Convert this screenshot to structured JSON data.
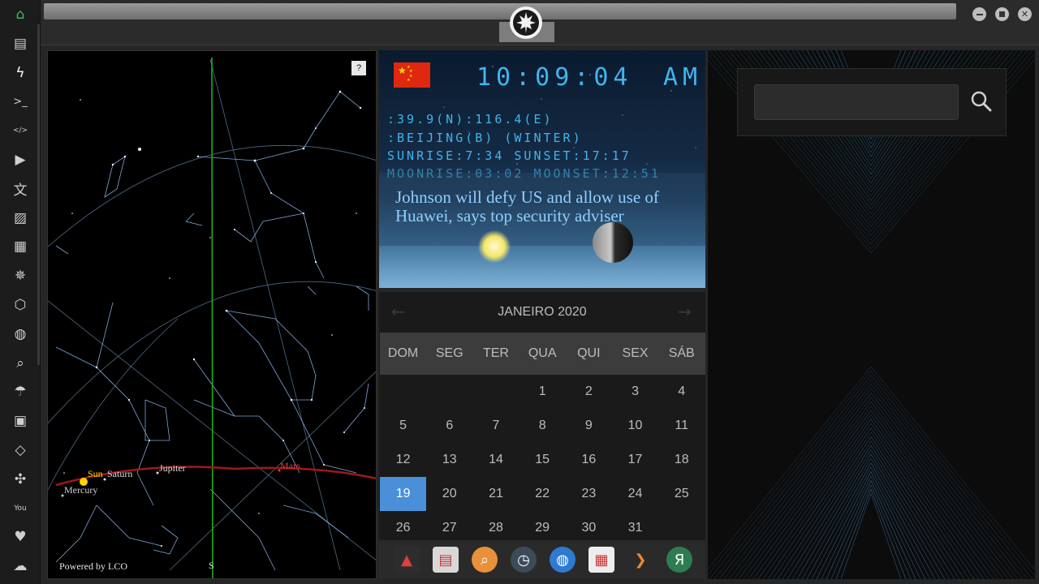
{
  "window": {
    "emblem": "rebel-alliance-icon"
  },
  "sidebar": {
    "items": [
      {
        "name": "home-icon",
        "glyph": "⌂"
      },
      {
        "name": "document-icon",
        "glyph": "▤"
      },
      {
        "name": "lightning-icon",
        "glyph": "ϟ"
      },
      {
        "name": "terminal-icon",
        "glyph": ">_"
      },
      {
        "name": "code-icon",
        "glyph": "</>"
      },
      {
        "name": "play-icon",
        "glyph": "▶"
      },
      {
        "name": "translate-icon",
        "glyph": "文"
      },
      {
        "name": "image-icon",
        "glyph": "▨"
      },
      {
        "name": "newspaper-icon",
        "glyph": "▦"
      },
      {
        "name": "galactic-empire-icon",
        "glyph": "✵"
      },
      {
        "name": "hexagon-icon",
        "glyph": "⬡"
      },
      {
        "name": "globe-icon",
        "glyph": "◍"
      },
      {
        "name": "search-icon",
        "glyph": "⌕"
      },
      {
        "name": "umbrella-icon",
        "glyph": "☂"
      },
      {
        "name": "contacts-icon",
        "glyph": "▣"
      },
      {
        "name": "dev-icon",
        "glyph": "◇"
      },
      {
        "name": "expand-icon",
        "glyph": "✣"
      },
      {
        "name": "youtube-icon",
        "glyph": "You"
      },
      {
        "name": "heart-icon",
        "glyph": "♥"
      },
      {
        "name": "cloud-icon",
        "glyph": "☁"
      }
    ]
  },
  "skymap": {
    "help_label": "?",
    "powered_by": "Powered by LCO",
    "south_label": "S",
    "planets": [
      {
        "label": "Sun",
        "color": "#ffd700"
      },
      {
        "label": "Saturn",
        "color": "#dddddd"
      },
      {
        "label": "Jupiter",
        "color": "#dddddd"
      },
      {
        "label": "Mars",
        "color": "#e23a3a"
      },
      {
        "label": "Mercury",
        "color": "#cccccc"
      }
    ]
  },
  "clock": {
    "time": "10:09:04",
    "ampm": "AM",
    "coords": ":39.9(N):116.4(E)",
    "city": ":BEIJING(B) (WINTER)",
    "sun_times": "SUNRISE:7:34 SUNSET:17:17",
    "moon_times": "MOONRISE:03:02 MOONSET:12:51",
    "headline": "Johnson will defy US and allow use of Huawei, says top security adviser",
    "accent": "#3fb5ee"
  },
  "calendar": {
    "title": "JANEIRO 2020",
    "weekdays": [
      "DOM",
      "SEG",
      "TER",
      "QUA",
      "QUI",
      "SEX",
      "SÁB"
    ],
    "weeks": [
      [
        "",
        "",
        "",
        "1",
        "2",
        "3",
        "4"
      ],
      [
        "5",
        "6",
        "7",
        "8",
        "9",
        "10",
        "11"
      ],
      [
        "12",
        "13",
        "14",
        "15",
        "16",
        "17",
        "18"
      ],
      [
        "19",
        "20",
        "21",
        "22",
        "23",
        "24",
        "25"
      ],
      [
        "26",
        "27",
        "28",
        "29",
        "30",
        "31",
        ""
      ]
    ],
    "today": "19",
    "today_color": "#4a90d9"
  },
  "dock": {
    "items": [
      {
        "name": "app-launcher-icon",
        "glyph": "▲",
        "bg": "#2d2d2d",
        "fg": "#e04040"
      },
      {
        "name": "news-reader-icon",
        "glyph": "▤",
        "bg": "#d8d8d8",
        "fg": "#c33"
      },
      {
        "name": "search-app-icon",
        "glyph": "⌕",
        "bg": "#e8913a",
        "fg": "#fff"
      },
      {
        "name": "clock-app-icon",
        "glyph": "◷",
        "bg": "#3d4a5a",
        "fg": "#fff"
      },
      {
        "name": "browser-icon",
        "glyph": "◍",
        "bg": "#2f7ad1",
        "fg": "#fff"
      },
      {
        "name": "calendar-app-icon",
        "glyph": "▦",
        "bg": "#ededed",
        "fg": "#c33"
      },
      {
        "name": "play-app-icon",
        "glyph": "❯",
        "bg": "transparent",
        "fg": "#f08a2e"
      },
      {
        "name": "yandex-icon",
        "glyph": "Я",
        "bg": "#2e7d52",
        "fg": "#fff"
      }
    ]
  },
  "search": {
    "placeholder": "",
    "value": ""
  }
}
